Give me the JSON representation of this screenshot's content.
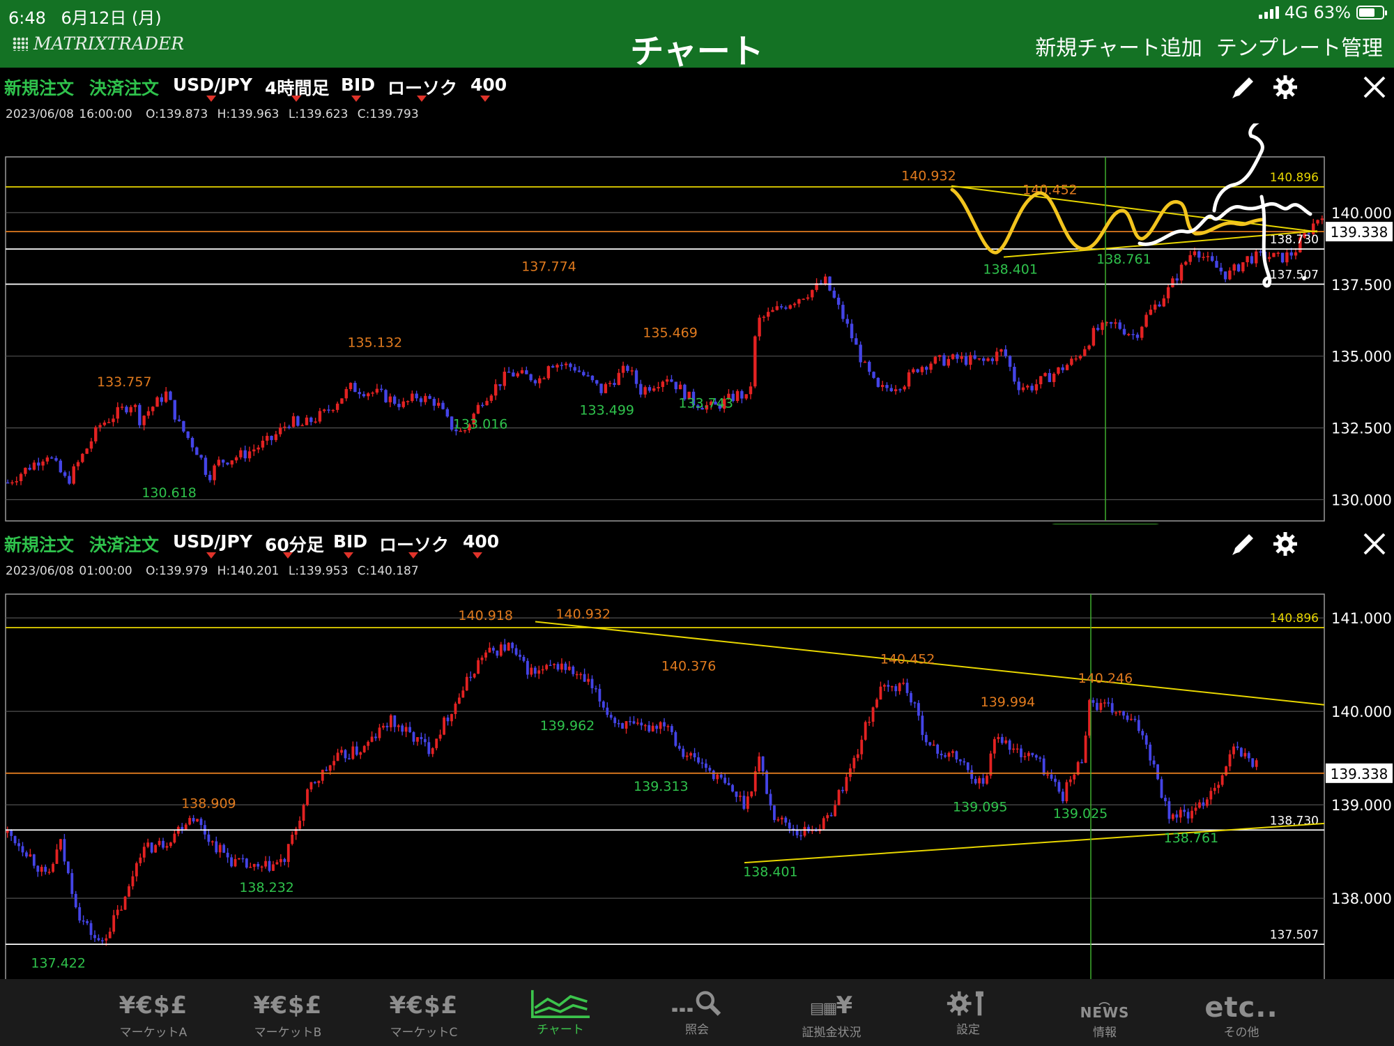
{
  "status_bar": {
    "time": "6:48",
    "date": "6月12日 (月)",
    "network": "4G",
    "battery": "63%"
  },
  "header": {
    "logo": "MATRIXTRADER",
    "title": "チャート",
    "add_chart": "新規チャート追加",
    "template_manage": "テンプレート管理"
  },
  "colors": {
    "header_bg": "#147224",
    "bull": "#e32222",
    "bear": "#4444e6",
    "high_label": "#e07a1e",
    "low_label": "#2fc24c",
    "trendline": "#e8d600"
  },
  "charts": [
    {
      "new_order": "新規注文",
      "settle_order": "決済注文",
      "symbol": "USD/JPY",
      "timeframe": "4時間足",
      "price_type": "BID",
      "chart_type": "ローソク",
      "count": "400",
      "ohlc": {
        "datetime": "2023/06/08 16:00:00",
        "open": "O:139.873",
        "high": "H:139.963",
        "low": "L:139.623",
        "close": "C:139.793"
      },
      "crosshair_label": "2023/06/08 16:00",
      "current_price": "139.338"
    },
    {
      "new_order": "新規注文",
      "settle_order": "決済注文",
      "symbol": "USD/JPY",
      "timeframe": "60分足",
      "price_type": "BID",
      "chart_type": "ローソク",
      "count": "400",
      "ohlc": {
        "datetime": "2023/06/08 01:00:00",
        "open": "O:139.979",
        "high": "H:140.201",
        "low": "L:139.953",
        "close": "C:140.187"
      },
      "crosshair_label": "06/08 01:00",
      "current_price": "139.338"
    }
  ],
  "chart_data": [
    {
      "type": "candlestick",
      "title": "USD/JPY 4時間足",
      "y_ticks": [
        "130.000",
        "132.500",
        "135.000",
        "137.500",
        "140.000"
      ],
      "ylim": [
        129.6,
        141.6
      ],
      "horizontal_lines": [
        {
          "value": 140.896,
          "label": "140.896",
          "color": "#e8d600"
        },
        {
          "value": 139.338,
          "label": "",
          "color": "#e07a1e"
        },
        {
          "value": 138.73,
          "label": "138.730",
          "color": "#ffffff"
        },
        {
          "value": 137.507,
          "label": "137.507",
          "color": "#ffffff"
        }
      ],
      "path": [
        [
          0,
          130.6
        ],
        [
          0.03,
          131.6
        ],
        [
          0.045,
          130.6
        ],
        [
          0.07,
          132.6
        ],
        [
          0.095,
          133.4
        ],
        [
          0.1,
          132.8
        ],
        [
          0.12,
          133.7
        ],
        [
          0.13,
          132.6
        ],
        [
          0.145,
          131.6
        ],
        [
          0.152,
          130.8
        ],
        [
          0.16,
          131.3
        ],
        [
          0.18,
          131.6
        ],
        [
          0.2,
          132.1
        ],
        [
          0.215,
          132.8
        ],
        [
          0.22,
          132.5
        ],
        [
          0.24,
          133.0
        ],
        [
          0.26,
          133.9
        ],
        [
          0.28,
          133.7
        ],
        [
          0.3,
          133.3
        ],
        [
          0.31,
          133.6
        ],
        [
          0.325,
          133.4
        ],
        [
          0.335,
          132.6
        ],
        [
          0.345,
          132.3
        ],
        [
          0.36,
          133.5
        ],
        [
          0.38,
          134.4
        ],
        [
          0.405,
          134.2
        ],
        [
          0.41,
          134.8
        ],
        [
          0.43,
          134.6
        ],
        [
          0.45,
          133.8
        ],
        [
          0.47,
          134.6
        ],
        [
          0.48,
          133.8
        ],
        [
          0.5,
          134.3
        ],
        [
          0.52,
          133.4
        ],
        [
          0.535,
          133.2
        ],
        [
          0.555,
          133.7
        ],
        [
          0.562,
          133.4
        ],
        [
          0.568,
          136.2
        ],
        [
          0.59,
          136.8
        ],
        [
          0.61,
          137.3
        ],
        [
          0.62,
          137.6
        ],
        [
          0.635,
          136.2
        ],
        [
          0.65,
          134.6
        ],
        [
          0.66,
          133.8
        ],
        [
          0.68,
          134.1
        ],
        [
          0.69,
          134.6
        ],
        [
          0.7,
          134.8
        ],
        [
          0.72,
          134.9
        ],
        [
          0.74,
          134.8
        ],
        [
          0.755,
          135.2
        ],
        [
          0.765,
          134.0
        ],
        [
          0.775,
          133.9
        ],
        [
          0.79,
          134.3
        ],
        [
          0.81,
          134.9
        ],
        [
          0.825,
          135.9
        ],
        [
          0.84,
          136.1
        ],
        [
          0.855,
          135.7
        ],
        [
          0.862,
          136.3
        ],
        [
          0.88,
          137.3
        ],
        [
          0.9,
          138.8
        ],
        [
          0.91,
          138.3
        ],
        [
          0.925,
          137.8
        ],
        [
          0.94,
          138.4
        ],
        [
          0.955,
          138.5
        ],
        [
          0.965,
          138.4
        ],
        [
          0.975,
          138.6
        ],
        [
          0.985,
          139.3
        ],
        [
          1.0,
          140.2
        ]
      ],
      "annotations": [
        {
          "text": "140.932",
          "kind": "high",
          "x": 0.7,
          "value": 140.932
        },
        {
          "text": "140.452",
          "kind": "high",
          "x": 0.792,
          "value": 140.452
        },
        {
          "text": "137.774",
          "kind": "high",
          "x": 0.412,
          "value": 137.774
        },
        {
          "text": "135.469",
          "kind": "high",
          "x": 0.504,
          "value": 135.469
        },
        {
          "text": "135.132",
          "kind": "high",
          "x": 0.28,
          "value": 135.132
        },
        {
          "text": "133.757",
          "kind": "high",
          "x": 0.09,
          "value": 133.757
        },
        {
          "text": "138.401",
          "kind": "low",
          "x": 0.762,
          "value": 138.401
        },
        {
          "text": "138.761",
          "kind": "low",
          "x": 0.848,
          "value": 138.761
        },
        {
          "text": "133.016",
          "kind": "low",
          "x": 0.36,
          "value": 133.016
        },
        {
          "text": "133.499",
          "kind": "low",
          "x": 0.456,
          "value": 133.499
        },
        {
          "text": "133.743",
          "kind": "low",
          "x": 0.531,
          "value": 133.743
        },
        {
          "text": "130.618",
          "kind": "low",
          "x": 0.124,
          "value": 130.618
        }
      ]
    },
    {
      "type": "candlestick",
      "title": "USD/JPY 60分足",
      "y_ticks": [
        "138.000",
        "139.000",
        "140.000",
        "141.000"
      ],
      "ylim": [
        137.15,
        141.15
      ],
      "horizontal_lines": [
        {
          "value": 140.896,
          "label": "140.896",
          "color": "#e8d600"
        },
        {
          "value": 139.338,
          "label": "",
          "color": "#e07a1e"
        },
        {
          "value": 138.73,
          "label": "138.730",
          "color": "#ffffff"
        },
        {
          "value": 137.507,
          "label": "137.507",
          "color": "#ffffff"
        }
      ],
      "path": [
        [
          0,
          138.7
        ],
        [
          0.015,
          138.5
        ],
        [
          0.03,
          138.2
        ],
        [
          0.04,
          138.6
        ],
        [
          0.045,
          138.3
        ],
        [
          0.055,
          137.8
        ],
        [
          0.065,
          137.6
        ],
        [
          0.07,
          137.5
        ],
        [
          0.09,
          138.0
        ],
        [
          0.1,
          138.5
        ],
        [
          0.12,
          138.6
        ],
        [
          0.14,
          138.9
        ],
        [
          0.155,
          138.6
        ],
        [
          0.17,
          138.4
        ],
        [
          0.19,
          138.3
        ],
        [
          0.21,
          138.4
        ],
        [
          0.22,
          138.8
        ],
        [
          0.23,
          139.2
        ],
        [
          0.25,
          139.5
        ],
        [
          0.27,
          139.6
        ],
        [
          0.29,
          139.9
        ],
        [
          0.3,
          139.8
        ],
        [
          0.32,
          139.6
        ],
        [
          0.34,
          140.1
        ],
        [
          0.36,
          140.6
        ],
        [
          0.38,
          140.7
        ],
        [
          0.39,
          140.5
        ],
        [
          0.4,
          140.4
        ],
        [
          0.42,
          140.5
        ],
        [
          0.44,
          140.3
        ],
        [
          0.46,
          139.9
        ],
        [
          0.48,
          139.8
        ],
        [
          0.5,
          139.9
        ],
        [
          0.51,
          139.6
        ],
        [
          0.53,
          139.4
        ],
        [
          0.545,
          139.2
        ],
        [
          0.56,
          139.0
        ],
        [
          0.57,
          139.5
        ],
        [
          0.58,
          138.9
        ],
        [
          0.6,
          138.7
        ],
        [
          0.62,
          138.8
        ],
        [
          0.64,
          139.4
        ],
        [
          0.65,
          139.8
        ],
        [
          0.66,
          140.2
        ],
        [
          0.68,
          140.3
        ],
        [
          0.7,
          139.6
        ],
        [
          0.72,
          139.5
        ],
        [
          0.74,
          139.2
        ],
        [
          0.75,
          139.8
        ],
        [
          0.76,
          139.6
        ],
        [
          0.78,
          139.5
        ],
        [
          0.8,
          139.1
        ],
        [
          0.815,
          139.5
        ],
        [
          0.82,
          140.1
        ],
        [
          0.84,
          140.0
        ],
        [
          0.86,
          139.8
        ],
        [
          0.87,
          139.4
        ],
        [
          0.88,
          138.9
        ],
        [
          0.9,
          138.9
        ],
        [
          0.91,
          139.1
        ],
        [
          0.92,
          139.3
        ],
        [
          0.93,
          139.6
        ],
        [
          0.94,
          139.5
        ],
        [
          0.95,
          139.4
        ]
      ],
      "annotations": [
        {
          "text": "140.918",
          "kind": "high",
          "x": 0.364,
          "value": 140.918
        },
        {
          "text": "140.932",
          "kind": "high",
          "x": 0.438,
          "value": 140.932
        },
        {
          "text": "140.376",
          "kind": "high",
          "x": 0.518,
          "value": 140.376
        },
        {
          "text": "140.452",
          "kind": "high",
          "x": 0.684,
          "value": 140.452
        },
        {
          "text": "140.246",
          "kind": "high",
          "x": 0.834,
          "value": 140.246
        },
        {
          "text": "139.994",
          "kind": "high",
          "x": 0.76,
          "value": 139.994
        },
        {
          "text": "138.909",
          "kind": "high",
          "x": 0.154,
          "value": 138.909
        },
        {
          "text": "139.962",
          "kind": "low",
          "x": 0.426,
          "value": 139.962
        },
        {
          "text": "139.313",
          "kind": "low",
          "x": 0.497,
          "value": 139.313
        },
        {
          "text": "139.095",
          "kind": "low",
          "x": 0.739,
          "value": 139.095
        },
        {
          "text": "139.025",
          "kind": "low",
          "x": 0.815,
          "value": 139.025
        },
        {
          "text": "138.761",
          "kind": "low",
          "x": 0.899,
          "value": 138.761
        },
        {
          "text": "138.401",
          "kind": "low",
          "x": 0.58,
          "value": 138.401
        },
        {
          "text": "138.232",
          "kind": "low",
          "x": 0.198,
          "value": 138.232
        },
        {
          "text": "137.422",
          "kind": "low",
          "x": 0.04,
          "value": 137.422
        }
      ]
    }
  ],
  "tabs": [
    {
      "icon": "¥€$£",
      "label": "マーケットA"
    },
    {
      "icon": "¥€$£",
      "label": "マーケットB"
    },
    {
      "icon": "¥€$£",
      "label": "マーケットC"
    },
    {
      "icon": "",
      "label": "チャート"
    },
    {
      "icon": "",
      "label": "照会"
    },
    {
      "icon": "¥",
      "label": "証拠金状況"
    },
    {
      "icon": "",
      "label": "設定"
    },
    {
      "icon": "NEWS",
      "label": "情報"
    },
    {
      "icon": "etc..",
      "label": "その他"
    }
  ],
  "active_tab": 3
}
